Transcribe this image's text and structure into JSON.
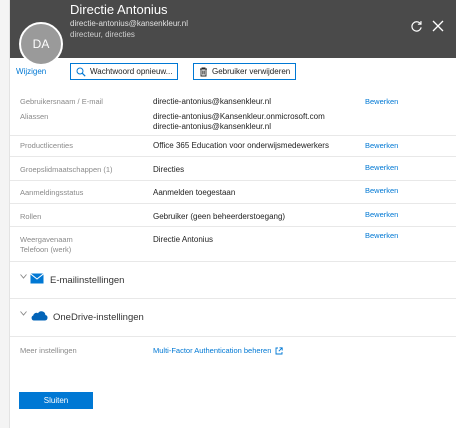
{
  "header": {
    "avatar_initials": "DA",
    "name": "Directie Antonius",
    "email": "directie-antonius@kansenkleur.nl",
    "roles": "directeur, directies"
  },
  "toolbar": {
    "edit_label": "Wijzigen",
    "reset_password_label": "Wachtwoord opnieuw...",
    "delete_user_label": "Gebruiker verwijderen"
  },
  "fields": {
    "username": {
      "label": "Gebruikersnaam / E-mail",
      "value": "directie-antonius@kansenkleur.nl",
      "action": "Bewerken"
    },
    "aliases": {
      "label": "Aliassen",
      "value1": "directie-antonius@Kansenkleur.onmicrosoft.com",
      "value2": "directie-antonius@kansenkleur.nl"
    },
    "licenses": {
      "label": "Productlicenties",
      "value": "Office 365 Education voor onderwijsmedewerkers",
      "action": "Bewerken"
    },
    "groups": {
      "label": "Groepslidmaatschappen (1)",
      "value": "Directies",
      "action": "Bewerken"
    },
    "signin": {
      "label": "Aanmeldingsstatus",
      "value": "Aanmelden toegestaan",
      "action": "Bewerken"
    },
    "roles": {
      "label": "Rollen",
      "value": "Gebruiker (geen beheerderstoegang)",
      "action": "Bewerken"
    },
    "display": {
      "label1": "Weergavenaam",
      "label2": "Telefoon (werk)",
      "value": "Directie Antonius",
      "action": "Bewerken"
    }
  },
  "sections": {
    "email": "E-mailinstellingen",
    "onedrive": "OneDrive-instellingen"
  },
  "more": {
    "label": "Meer instellingen",
    "mfa_link": "Multi-Factor Authentication beheren"
  },
  "footer": {
    "close_label": "Sluiten"
  },
  "colors": {
    "accent": "#0078d4",
    "header_bg": "#4a4a4a"
  }
}
